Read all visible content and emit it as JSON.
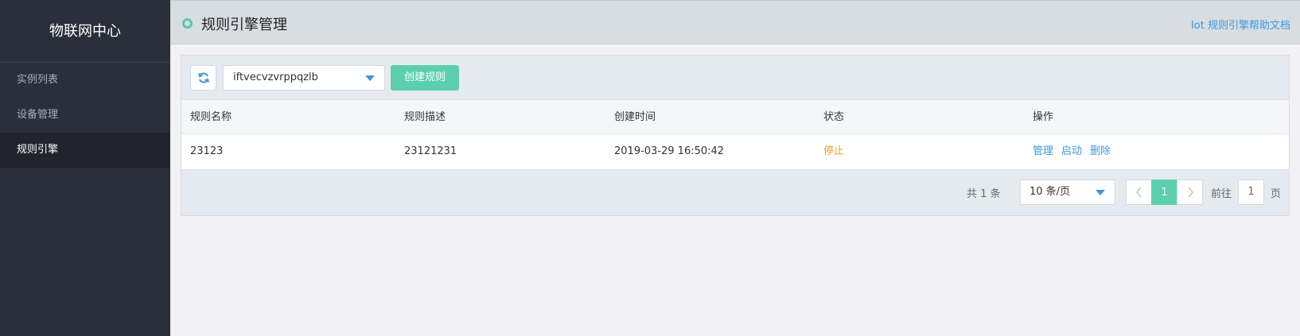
{
  "sidebar": {
    "brand": "物联网中心",
    "items": [
      {
        "label": "实例列表",
        "active": false
      },
      {
        "label": "设备管理",
        "active": false
      },
      {
        "label": "规则引擎",
        "active": true
      }
    ]
  },
  "header": {
    "title": "规则引擎管理",
    "help_link": "Iot 规则引擎帮助文档"
  },
  "toolbar": {
    "refresh_icon": "refresh-icon",
    "instance_select_value": "iftvecvzvrppqzlb",
    "create_label": "创建规则"
  },
  "table": {
    "columns": [
      "规则名称",
      "规则描述",
      "创建时间",
      "状态",
      "操作"
    ],
    "rows": [
      {
        "name": "23123",
        "description": "23121231",
        "created": "2019-03-29 16:50:42",
        "status": "停止",
        "actions": [
          "管理",
          "启动",
          "删除"
        ]
      }
    ]
  },
  "pagination": {
    "total_text": "共 1 条",
    "page_size": "10 条/页",
    "current_page": "1",
    "goto_label": "前往",
    "goto_value": "1",
    "goto_unit": "页"
  },
  "colors": {
    "accent": "#5ccfae",
    "link": "#3b98e0",
    "status_stopped": "#f0a020",
    "sidebar_bg": "#2b2f3a"
  }
}
